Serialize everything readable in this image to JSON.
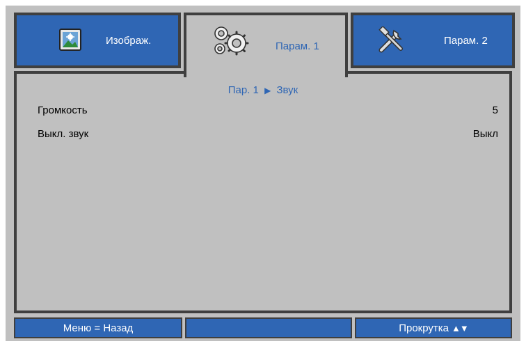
{
  "tabs": [
    {
      "label": "Изображ.",
      "icon": "picture-icon",
      "active": false
    },
    {
      "label": "Парам. 1",
      "icon": "gears-icon",
      "active": true
    },
    {
      "label": "Парам. 2",
      "icon": "tools-icon",
      "active": false
    }
  ],
  "breadcrumb": {
    "parent": "Пар. 1",
    "separator": "▶",
    "current": "Звук"
  },
  "items": [
    {
      "label": "Громкость",
      "value": "5"
    },
    {
      "label": "Выкл. звук",
      "value": "Выкл"
    }
  ],
  "footer": {
    "left": "Меню = Назад",
    "middle": "",
    "right": "Прокрутка",
    "arrows": "▲▼"
  },
  "colors": {
    "accent": "#2f66b4",
    "panel": "#c0c0c0",
    "border": "#3f3f3f"
  }
}
